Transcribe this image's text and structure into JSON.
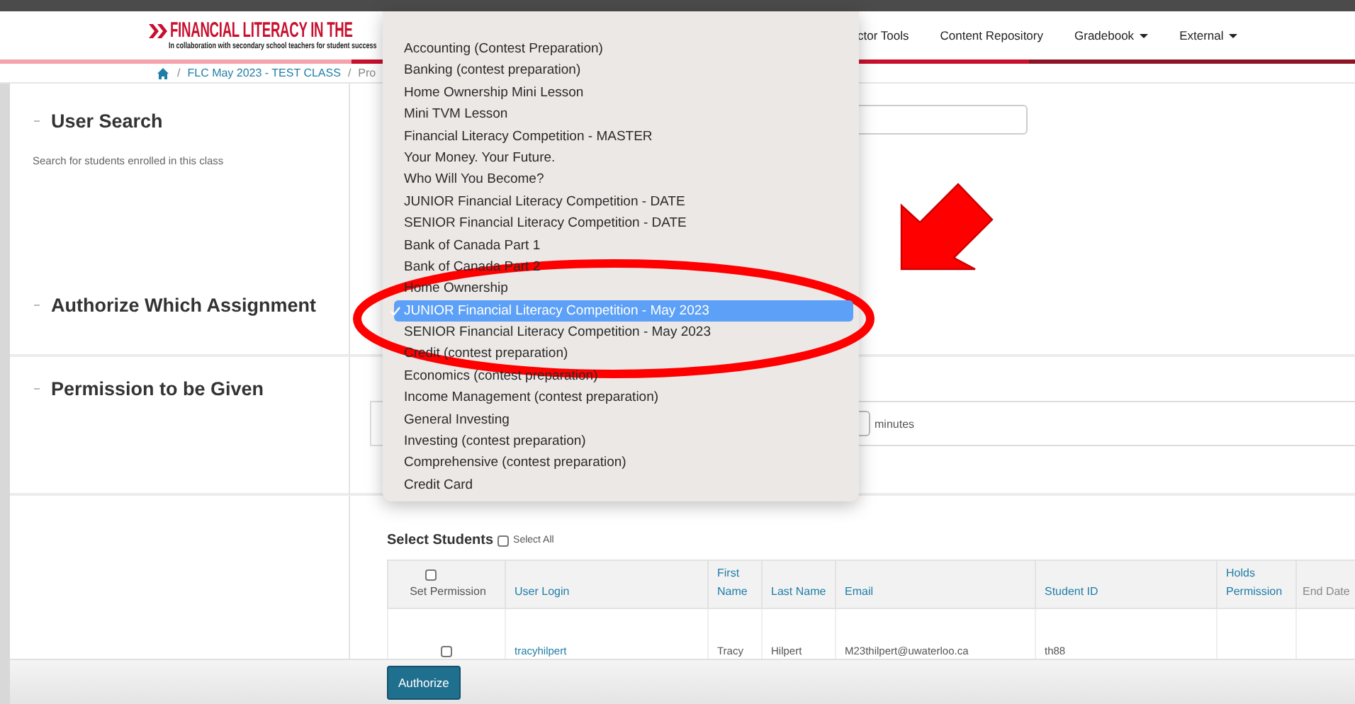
{
  "header": {
    "logo_title": "FINANCIAL LITERACY IN THE",
    "logo_subtitle": "In collaboration with secondary school teachers for student success",
    "nav": [
      {
        "label": "ctor Tools",
        "dropdown": false
      },
      {
        "label": "Content Repository",
        "dropdown": false
      },
      {
        "label": "Gradebook",
        "dropdown": true
      },
      {
        "label": "External",
        "dropdown": true
      }
    ]
  },
  "breadcrumb": {
    "separator": "/",
    "items": [
      "FLC May 2023 - TEST CLASS",
      "Pro"
    ]
  },
  "sections": [
    {
      "title": "User Search",
      "description": "Search for students enrolled in this class"
    },
    {
      "title": "Authorize Which Assignment"
    },
    {
      "title": "Permission to be Given"
    }
  ],
  "permission": {
    "unit": "minutes"
  },
  "assignment_menu": {
    "items": [
      {
        "label": "Accounting (Contest Preparation)",
        "selected": false
      },
      {
        "label": "Banking (contest preparation)",
        "selected": false
      },
      {
        "label": "Home Ownership Mini Lesson",
        "selected": false
      },
      {
        "label": "Mini TVM Lesson",
        "selected": false
      },
      {
        "label": "Financial Literacy Competition - MASTER",
        "selected": false
      },
      {
        "label": "Your Money. Your Future.",
        "selected": false
      },
      {
        "label": "Who Will You Become?",
        "selected": false
      },
      {
        "label": "JUNIOR Financial Literacy Competition - DATE",
        "selected": false
      },
      {
        "label": "SENIOR Financial Literacy Competition - DATE",
        "selected": false
      },
      {
        "label": "Bank of Canada Part 1",
        "selected": false
      },
      {
        "label": "Bank of Canada Part 2",
        "selected": false
      },
      {
        "label": "Home Ownership",
        "selected": false
      },
      {
        "label": "JUNIOR Financial Literacy Competition - May 2023",
        "selected": true
      },
      {
        "label": "SENIOR Financial Literacy Competition - May 2023",
        "selected": false
      },
      {
        "label": "Credit (contest preparation)",
        "selected": false
      },
      {
        "label": "Economics (contest preparation)",
        "selected": false
      },
      {
        "label": "Income Management (contest preparation)",
        "selected": false
      },
      {
        "label": "General Investing",
        "selected": false
      },
      {
        "label": "Investing (contest preparation)",
        "selected": false
      },
      {
        "label": "Comprehensive (contest preparation)",
        "selected": false
      },
      {
        "label": "Credit Card",
        "selected": false
      }
    ]
  },
  "select_students": {
    "title": "Select Students",
    "select_all": {
      "label": "Select All",
      "checked": false
    }
  },
  "table": {
    "columns": [
      {
        "label": "Set Permission",
        "kind": "check",
        "checked": false
      },
      {
        "label": "User Login",
        "kind": "link"
      },
      {
        "label": "First Name",
        "kind": "link"
      },
      {
        "label": "Last Name",
        "kind": "link"
      },
      {
        "label": "Email",
        "kind": "link"
      },
      {
        "label": "Student ID",
        "kind": "link"
      },
      {
        "label": "Holds Permission",
        "kind": "link"
      },
      {
        "label": "End Date",
        "kind": "plain"
      }
    ],
    "rows": [
      {
        "cells": [
          {
            "kind": "check",
            "checked": false
          },
          {
            "kind": "link",
            "text": "tracyhilpert"
          },
          {
            "kind": "text",
            "text": "Tracy"
          },
          {
            "kind": "text",
            "text": "Hilpert"
          },
          {
            "kind": "text",
            "text": "M23thilpert@uwaterloo.ca"
          },
          {
            "kind": "text",
            "text": "th88"
          }
        ]
      }
    ]
  },
  "authorize_button": "Authorize"
}
